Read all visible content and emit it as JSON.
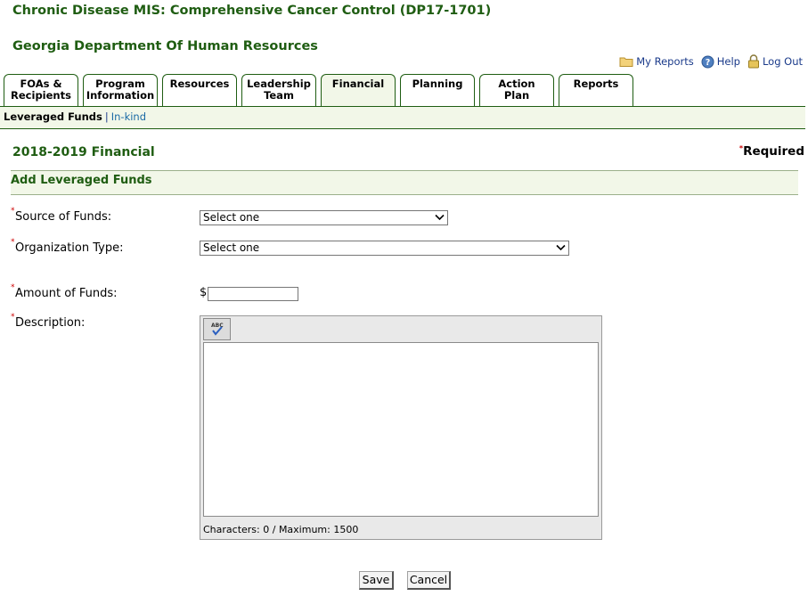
{
  "header": {
    "app_title": "Chronic Disease MIS: Comprehensive Cancer Control (DP17-1701)",
    "org_title": "Georgia Department Of Human Resources"
  },
  "toplinks": {
    "my_reports": "My Reports",
    "help": "Help",
    "logout": "Log Out"
  },
  "tabs": [
    {
      "line1": "FOAs &",
      "line2": "Recipients"
    },
    {
      "line1": "Program",
      "line2": "Information"
    },
    {
      "line1": "Resources",
      "line2": ""
    },
    {
      "line1": "Leadership",
      "line2": "Team"
    },
    {
      "line1": "Financial",
      "line2": "",
      "active": true
    },
    {
      "line1": "Planning",
      "line2": ""
    },
    {
      "line1": "Action",
      "line2": "Plan"
    },
    {
      "line1": "Reports",
      "line2": ""
    }
  ],
  "subnav": {
    "current": "Leveraged Funds",
    "separator": "|",
    "link": "In-kind"
  },
  "page": {
    "section_title": "2018-2019 Financial",
    "required_star": "*",
    "required_label": "Required",
    "form_heading": "Add Leveraged Funds"
  },
  "form": {
    "source_label": "Source of Funds:",
    "source_value": "Select one",
    "org_type_label": "Organization Type:",
    "org_type_value": "Select one",
    "amount_label": "Amount of Funds:",
    "currency": "$",
    "amount_value": "",
    "description_label": "Description:",
    "description_value": "",
    "char_count": "Characters: 0 / Maximum: 1500",
    "required_marker": "*"
  },
  "buttons": {
    "save": "Save",
    "cancel": "Cancel"
  },
  "colors": {
    "brand_green": "#1f5d12",
    "tab_active_bg": "#f2f7e8",
    "link_blue": "#1a6aa5",
    "required_red": "#cc0000"
  },
  "icons": {
    "my_reports": "folder-icon",
    "help": "help-icon",
    "logout": "lock-icon",
    "spellcheck": "spellcheck-icon",
    "dropdown": "chevron-down-icon"
  }
}
